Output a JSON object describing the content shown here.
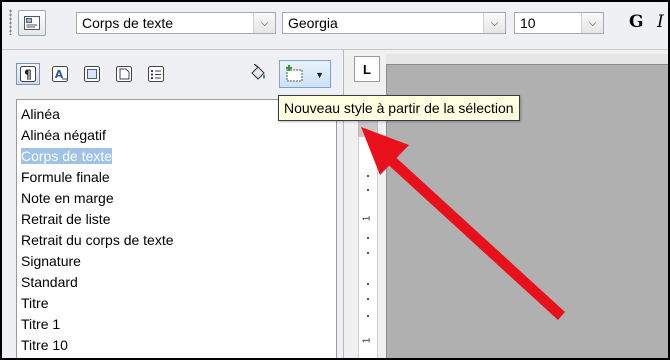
{
  "toolbar": {
    "paragraph_style": "Corps de texte",
    "font_name": "Georgia",
    "font_size": "10",
    "bold_label": "G",
    "italic_label": "I"
  },
  "styles_panel": {
    "category_icons": [
      "paragraph-styles-icon",
      "character-styles-icon",
      "frame-styles-icon",
      "page-styles-icon",
      "list-styles-icon"
    ],
    "fill_format_icon": "fill-format-icon",
    "new_style_icon": "new-style-from-selection-icon",
    "items": [
      "Alinéa",
      "Alinéa négatif",
      "Corps de texte",
      "Formule finale",
      "Note en marge",
      "Retrait de liste",
      "Retrait du corps de texte",
      "Signature",
      "Standard",
      "Titre",
      "Titre 1",
      "Titre 10"
    ],
    "selected_item": "Corps de texte"
  },
  "tooltip": "Nouveau style à partir de la sélection",
  "ruler": {
    "corner_label": "L",
    "labels": [
      "1",
      "1"
    ]
  },
  "colors": {
    "selection_bg": "#9fc2e8",
    "tooltip_bg": "#ffffe1",
    "arrow": "#e8101a",
    "document_bg": "#b0b0b0"
  }
}
